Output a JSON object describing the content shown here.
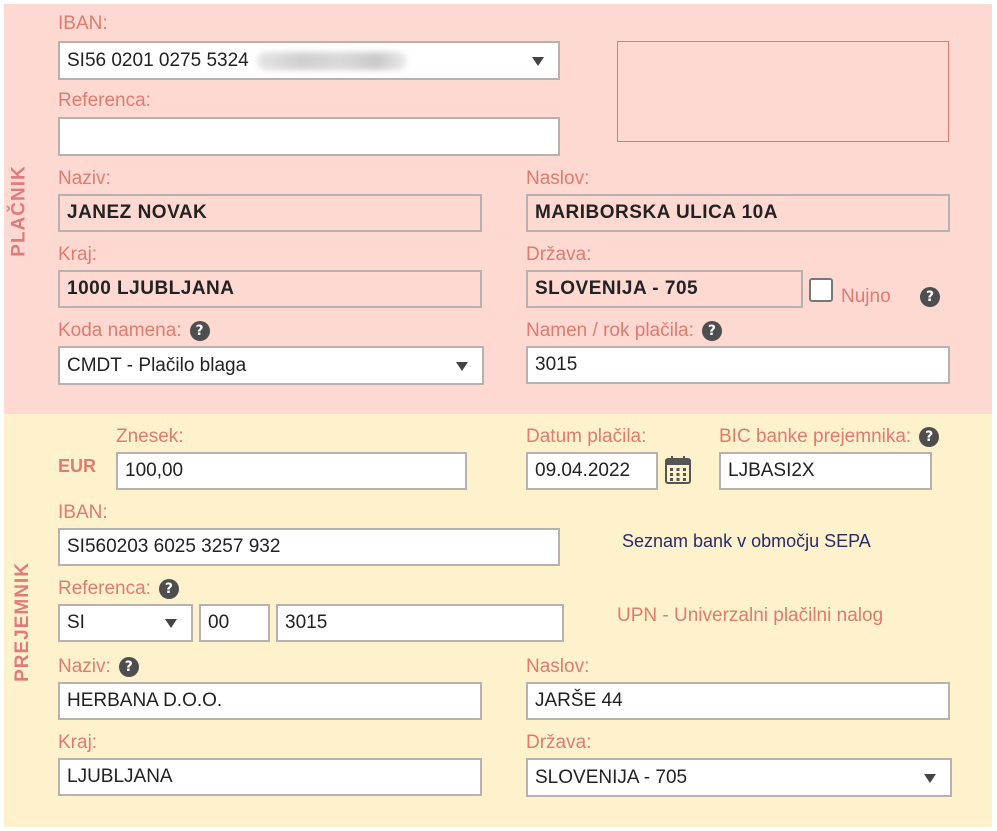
{
  "payer": {
    "section_label": "PLAČNIK",
    "iban_label": "IBAN:",
    "iban_value": "SI56 0201 0275 5324",
    "reference_label": "Referenca:",
    "reference_value": "",
    "name_label": "Naziv:",
    "name_value": "JANEZ NOVAK",
    "address_label": "Naslov:",
    "address_value": "MARIBORSKA ULICA 10A",
    "city_label": "Kraj:",
    "city_value": "1000 LJUBLJANA",
    "country_label": "Država:",
    "country_value": "SLOVENIJA - 705",
    "urgent_label": "Nujno",
    "purpose_code_label": "Koda namena:",
    "purpose_code_value": "CMDT - Plačilo blaga",
    "purpose_label": "Namen / rok plačila:",
    "purpose_value": "3015"
  },
  "payee": {
    "section_label": "PREJEMNIK",
    "currency": "EUR",
    "amount_label": "Znesek:",
    "amount_value": "100,00",
    "date_label": "Datum plačila:",
    "date_value": "09.04.2022",
    "bic_label": "BIC banke prejemnika:",
    "bic_value": "LJBASI2X",
    "iban_label": "IBAN:",
    "iban_value": "SI560203 6025 3257 932",
    "sepa_link": "Seznam bank v območju SEPA",
    "reference_label": "Referenca:",
    "reference_model": "SI",
    "reference_code": "00",
    "reference_number": "3015",
    "upn_link": "UPN - Univerzalni plačilni nalog",
    "name_label": "Naziv:",
    "name_value": "HERBANA D.O.O.",
    "address_label": "Naslov:",
    "address_value": "JARŠE 44",
    "city_label": "Kraj:",
    "city_value": "LJUBLJANA",
    "country_label": "Država:",
    "country_value": "SLOVENIJA - 705"
  },
  "help_symbol": "?",
  "colors": {
    "payer_bg": "#fdd9d2",
    "payee_bg": "#fdf2cc",
    "label": "#e07b70",
    "link": "#2a2a6e"
  }
}
